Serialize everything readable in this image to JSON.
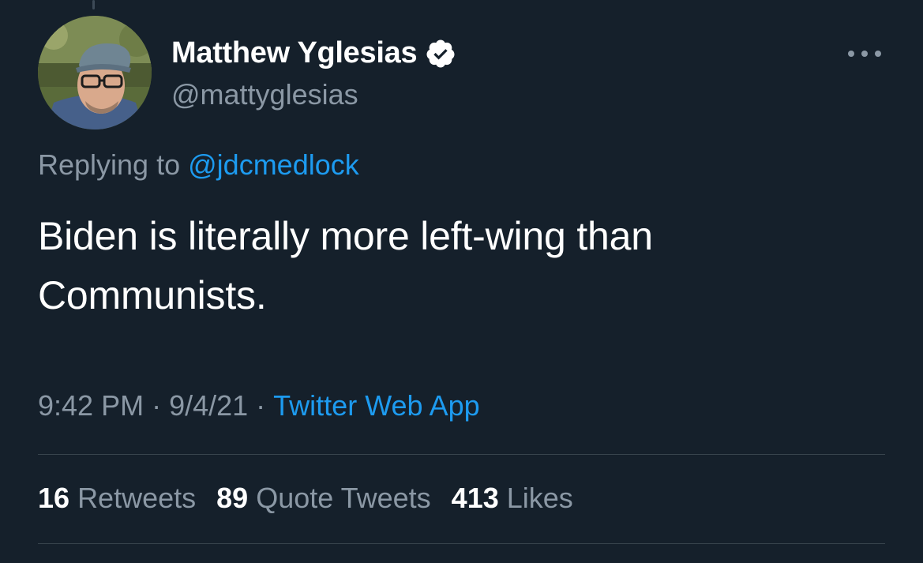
{
  "author": {
    "display_name": "Matthew Yglesias",
    "handle": "@mattyglesias",
    "verified_icon": "verified-badge-icon",
    "avatar_icon": "profile-photo"
  },
  "more_icon": "more-horizontal-icon",
  "reply": {
    "prefix": "Replying to",
    "to_handle": "@jdcmedlock"
  },
  "tweet": {
    "line1": "Biden is literally more left-wing than",
    "line2": "Communists."
  },
  "meta": {
    "time": "9:42 PM",
    "date": "9/4/21",
    "source": "Twitter Web App",
    "separator": "·"
  },
  "stats": {
    "retweets_count": "16",
    "retweets_label": "Retweets",
    "quotes_count": "89",
    "quotes_label": "Quote Tweets",
    "likes_count": "413",
    "likes_label": "Likes"
  },
  "colors": {
    "background": "#15202b",
    "text_primary": "#ffffff",
    "text_secondary": "#8b98a5",
    "accent": "#1d9bf0",
    "divider": "#38444d"
  }
}
